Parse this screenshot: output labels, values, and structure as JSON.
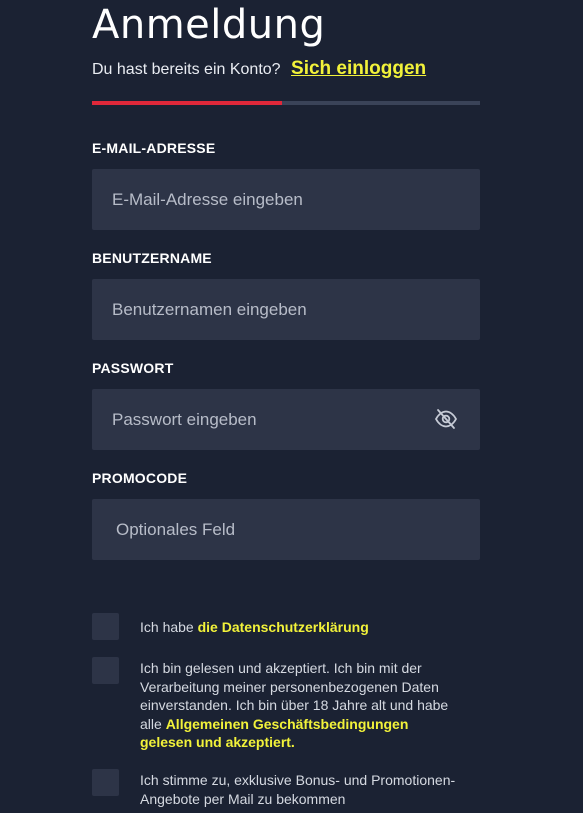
{
  "header": {
    "title": "Anmeldung",
    "subtitle": "Du hast bereits ein Konto?",
    "login_link": "Sich einloggen"
  },
  "progress": {
    "fraction": 0.49,
    "fill_color": "#e0283a",
    "track_color": "#3a4358"
  },
  "fields": {
    "email": {
      "label": "E-MAIL-ADRESSE",
      "placeholder": "E-Mail-Adresse eingeben",
      "value": ""
    },
    "username": {
      "label": "BENUTZERNAME",
      "placeholder": "Benutzernamen eingeben",
      "value": ""
    },
    "password": {
      "label": "PASSWORT",
      "placeholder": "Passwort eingeben",
      "value": "",
      "toggle_icon": "eye-slash-icon"
    },
    "promo": {
      "label": "PROMOCODE",
      "placeholder": "Optionales Feld",
      "value": ""
    }
  },
  "checkboxes": {
    "privacy": {
      "text": "Ich habe ",
      "link": "die Datenschutzerklärung",
      "checked": false
    },
    "terms": {
      "text": "Ich bin gelesen und akzeptiert. Ich bin mit der Verarbeitung meiner personenbezogenen Daten einverstanden. Ich bin über 18 Jahre alt und habe alle ",
      "link": "Allgemeinen Geschäftsbedingungen gelesen und akzeptiert.",
      "checked": false
    },
    "bonus": {
      "text": "Ich stimme zu, exklusive Bonus- und Promotionen-Angebote per Mail zu bekommen",
      "checked": false
    }
  },
  "colors": {
    "background": "#1b2233",
    "field": "#2d3447",
    "accent_link": "#f2f23a",
    "accent_red": "#e0283a"
  }
}
